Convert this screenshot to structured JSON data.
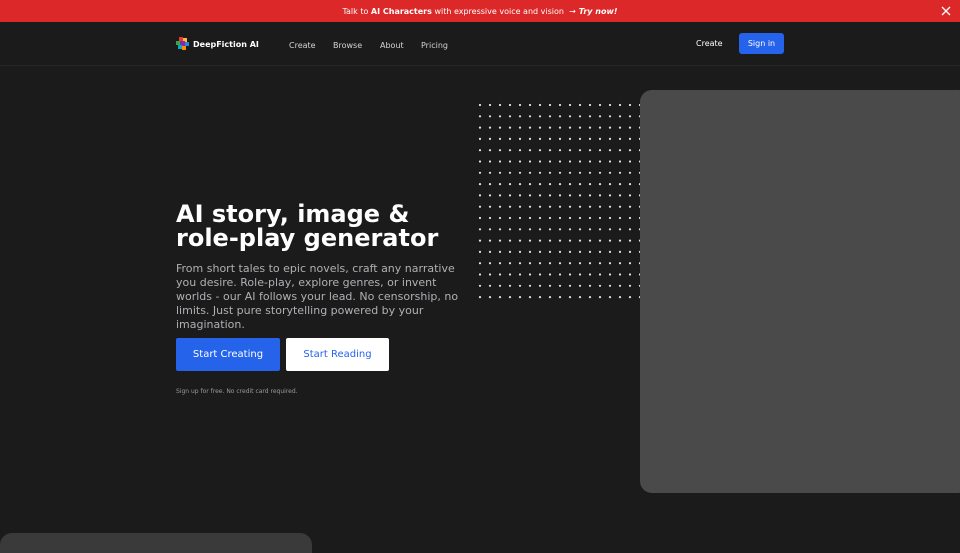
{
  "banner": {
    "prefix": "Talk to",
    "highlight": "AI Characters",
    "suffix": "with expressive voice and vision",
    "arrow": "→",
    "cta": "Try now!"
  },
  "nav": {
    "brand": "DeepFiction AI",
    "links": [
      "Create",
      "Browse",
      "About",
      "Pricing"
    ],
    "create_right": "Create",
    "signin": "Sign in"
  },
  "hero": {
    "title": "AI story, image & role-play generator",
    "lead": "From short tales to epic novels, craft any narrative you desire. Role-play, explore genres, or invent worlds - our AI follows your lead. No censorship, no limits. Just pure storytelling powered by your imagination.",
    "primary_button": "Start Creating",
    "secondary_button": "Start Reading",
    "fine_print": "Sign up for free. No credit card required."
  },
  "colors": {
    "banner": "#dc2828",
    "accent": "#2563eb",
    "background": "#1b1b1c",
    "panel": "#4a4a4b"
  }
}
